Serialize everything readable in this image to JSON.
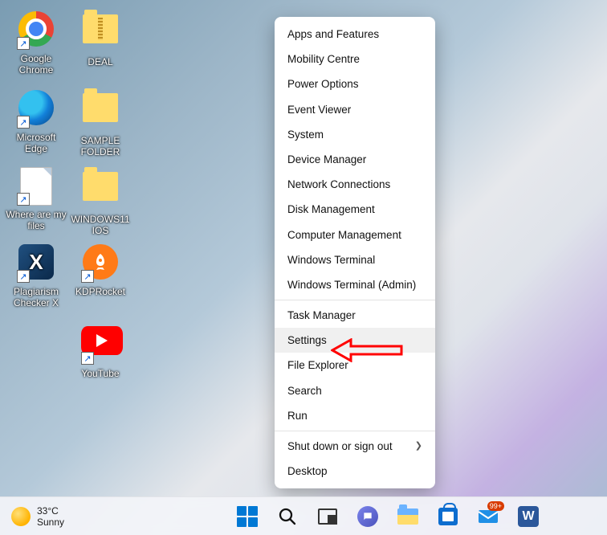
{
  "desktop_icons": {
    "chrome": "Google Chrome",
    "deal": "DEAL",
    "edge": "Microsoft Edge",
    "sample": "SAMPLE FOLDER",
    "where": "Where are my files",
    "win11": "WINDOWS11 IOS",
    "plag": "Plagiarism Checker X",
    "kdp": "KDPRocket",
    "youtube": "YouTube"
  },
  "context_menu": {
    "items": [
      "Apps and Features",
      "Mobility Centre",
      "Power Options",
      "Event Viewer",
      "System",
      "Device Manager",
      "Network Connections",
      "Disk Management",
      "Computer Management",
      "Windows Terminal",
      "Windows Terminal (Admin)",
      "Task Manager",
      "Settings",
      "File Explorer",
      "Search",
      "Run",
      "Shut down or sign out",
      "Desktop"
    ],
    "highlighted_index": 12,
    "submenu_index": 16
  },
  "taskbar": {
    "weather": {
      "temp": "33°C",
      "condition": "Sunny"
    },
    "mail_badge": "99+",
    "word_label": "W"
  }
}
